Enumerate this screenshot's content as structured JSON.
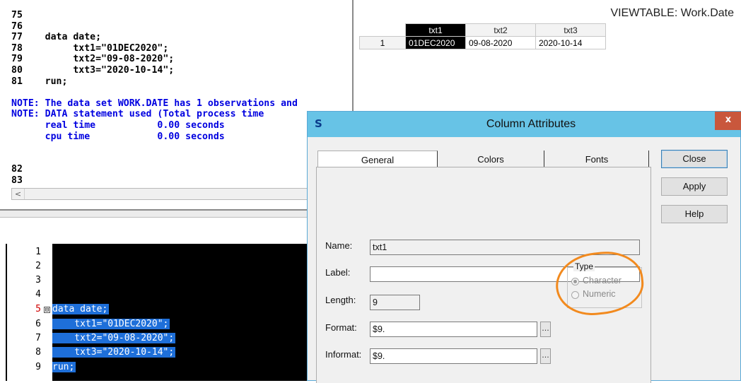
{
  "log": {
    "lines": [
      {
        "kind": "num",
        "text": "75"
      },
      {
        "kind": "num",
        "text": "76"
      },
      {
        "kind": "num",
        "text": "77    data date;"
      },
      {
        "kind": "num",
        "text": "78         txt1=\"01DEC2020\";"
      },
      {
        "kind": "num",
        "text": "79         txt2=\"09-08-2020\";"
      },
      {
        "kind": "num",
        "text": "80         txt3=\"2020-10-14\";"
      },
      {
        "kind": "num",
        "text": "81    run;"
      },
      {
        "kind": "num",
        "text": ""
      },
      {
        "kind": "note",
        "text": "NOTE: The data set WORK.DATE has 1 observations and"
      },
      {
        "kind": "note",
        "text": "NOTE: DATA statement used (Total process time"
      },
      {
        "kind": "note",
        "text": "      real time           0.00 seconds"
      },
      {
        "kind": "note",
        "text": "      cpu time            0.00 seconds"
      },
      {
        "kind": "num",
        "text": ""
      },
      {
        "kind": "num",
        "text": ""
      },
      {
        "kind": "num",
        "text": "82"
      },
      {
        "kind": "num",
        "text": "83"
      }
    ],
    "scroll_left_arrow": "<"
  },
  "viewtable": {
    "title": "VIEWTABLE: Work.Date",
    "columns": [
      "txt1",
      "txt2",
      "txt3"
    ],
    "rows": [
      {
        "rownum": "1",
        "cells": [
          "01DEC2020",
          "09-08-2020",
          "2020-10-14"
        ]
      }
    ]
  },
  "editor": {
    "line_numbers": [
      "1",
      "2",
      "3",
      "4",
      "5",
      "6",
      "7",
      "8",
      "9"
    ],
    "fold_symbol": "⊟",
    "code_lines": [
      {
        "line": "5",
        "text": "data date;"
      },
      {
        "line": "6",
        "text": "    txt1=\"01DEC2020\";"
      },
      {
        "line": "7",
        "text": "    txt2=\"09-08-2020\";"
      },
      {
        "line": "8",
        "text": "    txt3=\"2020-10-14\";"
      },
      {
        "line": "9",
        "text": "run;"
      }
    ]
  },
  "dialog": {
    "title": "Column Attributes",
    "app_icon": "S",
    "close_glyph": "x",
    "tabs": [
      "General",
      "Colors",
      "Fonts"
    ],
    "active_tab": "General",
    "fields": {
      "name_label": "Name:",
      "name_value": "txt1",
      "label_label": "Label:",
      "label_value": "",
      "length_label": "Length:",
      "length_value": "9",
      "format_label": "Format:",
      "format_value": "$9.",
      "informat_label": "Informat:",
      "informat_value": "$9.",
      "ellipsis": "..."
    },
    "type_group": {
      "legend": "Type",
      "options": [
        "Character",
        "Numeric"
      ],
      "selected": "Character"
    },
    "buttons": {
      "close": "Close",
      "apply": "Apply",
      "help": "Help"
    }
  },
  "colors": {
    "title_bar": "#67c3e6",
    "note_text": "#0000e0",
    "selection": "#1e6fd9",
    "annotation": "#f28a1e"
  }
}
